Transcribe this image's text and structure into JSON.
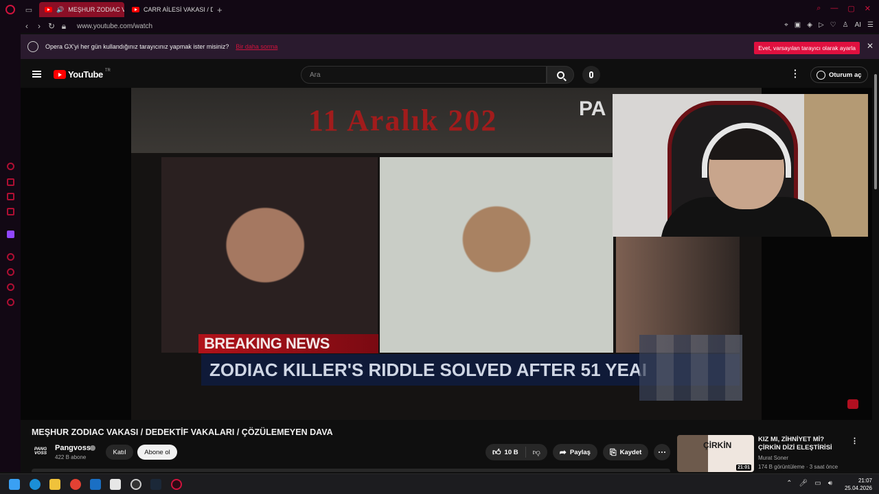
{
  "browser": {
    "tabs": [
      {
        "label": "MEŞHUR ZODIAC VAK",
        "active": true
      },
      {
        "label": "CARR AİLESİ VAKASI / DE",
        "active": false
      }
    ],
    "url": "www.youtube.com/watch",
    "accent": "#d0133d"
  },
  "notice": {
    "text": "Opera GX'yi her gün kullandığınız tarayıcınız yapmak ister misiniz?",
    "link": "Bir daha sorma",
    "button": "Evet, varsayılan tarayıcı olarak ayarla",
    "close": "✕"
  },
  "header": {
    "logo": "YouTube",
    "region": "TR",
    "search_placeholder": "Ara",
    "signin": "Oturum aç"
  },
  "video": {
    "date_text": "11 Aralık 202",
    "overlay_text": "PA",
    "breaking": "BREAKING NEWS",
    "headline": "ZODIAC KILLER'S RIDDLE SOLVED AFTER 51 YEAI"
  },
  "info": {
    "title": "MEŞHUR ZODIAC VAKASI / DEDEKTİF VAKALARI / ÇÖZÜLEMEYEN DAVA",
    "channel": "Pangvoss",
    "channel_logo": "PANG VOSS",
    "subscribers": "422 B abone",
    "join": "Katıl",
    "subscribe": "Abone ol",
    "likes": "10 B",
    "share": "Paylaş",
    "save": "Kaydet"
  },
  "recommendation": {
    "title": "KIZ MI, ZİHNİYET Mİ? ÇİRKİN DİZİ ELEŞTİRİSİ",
    "thumb_text": "ÇİRKİN",
    "channel": "Murat Soner",
    "views": "174 B görüntüleme · 3 saat önce",
    "duration": "21:01"
  },
  "taskbar": {
    "time": "21:07",
    "date": "25.04.2026"
  }
}
